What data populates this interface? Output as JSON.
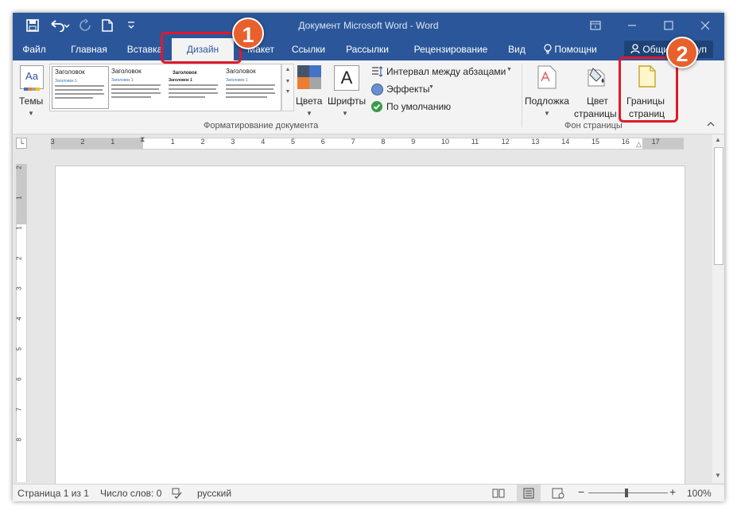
{
  "window": {
    "title": "Документ Microsoft Word - Word",
    "qat": [
      "save-icon",
      "undo-icon",
      "redo-icon",
      "new-doc-icon",
      "customize-icon"
    ],
    "accent": "#2b579a"
  },
  "tabs": [
    {
      "label": "Файл"
    },
    {
      "label": "Главная"
    },
    {
      "label": "Вставка"
    },
    {
      "label": "Дизайн"
    },
    {
      "label": "Макет"
    },
    {
      "label": "Ссылки"
    },
    {
      "label": "Рассылки"
    },
    {
      "label": "Рецензирование"
    },
    {
      "label": "Вид"
    }
  ],
  "tell_me": "Помощни",
  "share": "Общий доступ",
  "ribbon": {
    "themes_label": "Темы",
    "gallery": [
      {
        "title": "Заголовок",
        "sub": "Заголовок 1"
      },
      {
        "title": "Заголовок",
        "sub": "Заголовок 1"
      },
      {
        "title": "Заголовок",
        "sub": "Заголовок 1"
      },
      {
        "title": "Заголовок",
        "sub": "Заголовок 1"
      }
    ],
    "colors_label": "Цвета",
    "fonts_label": "Шрифты",
    "fonts_glyph": "A",
    "themes_glyph": "Aa",
    "paragraph_spacing": "Интервал между абзацами",
    "effects": "Эффекты",
    "set_default": "По умолчанию",
    "group_formatting": "Форматирование документа",
    "watermark_label": "Подложка",
    "page_color_label_1": "Цвет",
    "page_color_label_2": "страницы",
    "page_borders_label_1": "Границы",
    "page_borders_label_2": "страниц",
    "group_background": "Фон страницы"
  },
  "annotations": [
    {
      "number": "1",
      "color": "#e8602c"
    },
    {
      "number": "2",
      "color": "#e8602c"
    }
  ],
  "ruler": {
    "left_numbers": [
      "3",
      "2",
      "1"
    ],
    "numbers": [
      "1",
      "2",
      "3",
      "4",
      "5",
      "6",
      "7",
      "8",
      "9",
      "10",
      "11",
      "12",
      "13",
      "14",
      "15",
      "16",
      "17"
    ]
  },
  "vruler_numbers": [
    "2",
    "1",
    "1",
    "2",
    "3",
    "4",
    "5",
    "6",
    "7",
    "8"
  ],
  "status": {
    "page": "Страница 1 из 1",
    "words": "Число слов: 0",
    "language": "русский",
    "zoom": "100%"
  }
}
